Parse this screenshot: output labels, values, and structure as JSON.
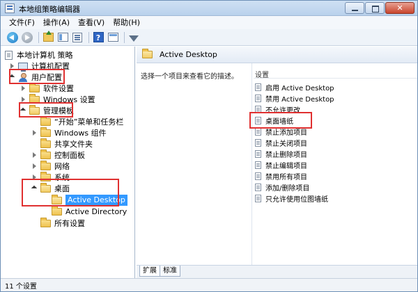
{
  "window": {
    "title": "本地组策略编辑器"
  },
  "menu": {
    "items": [
      "文件(F)",
      "操作(A)",
      "查看(V)",
      "帮助(H)"
    ]
  },
  "tree": {
    "items": [
      {
        "label": "本地计算机 策略"
      },
      {
        "label": "计算机配置"
      },
      {
        "label": "用户配置"
      },
      {
        "label": "软件设置"
      },
      {
        "label": "Windows 设置"
      },
      {
        "label": "管理模板"
      },
      {
        "label": "“开始”菜单和任务栏"
      },
      {
        "label": "Windows 组件"
      },
      {
        "label": "共享文件夹"
      },
      {
        "label": "控制面板"
      },
      {
        "label": "网络"
      },
      {
        "label": "系统"
      },
      {
        "label": "桌面"
      },
      {
        "label": "Active Desktop"
      },
      {
        "label": "Active Directory"
      },
      {
        "label": "所有设置"
      }
    ]
  },
  "right": {
    "header": "Active Desktop",
    "description": "选择一个项目来查看它的描述。",
    "column": "设置",
    "settings": [
      "启用 Active Desktop",
      "禁用 Active Desktop",
      "不允许更改",
      "桌面墙纸",
      "禁止添加项目",
      "禁止关闭项目",
      "禁止删除项目",
      "禁止编辑项目",
      "禁用所有项目",
      "添加/删除项目",
      "只允许使用位图墙纸"
    ],
    "tabs": [
      "扩展",
      "标准"
    ]
  },
  "status": {
    "text": "11 个设置"
  },
  "colors": {
    "highlight": "#3399ff",
    "annotation": "#e03030"
  }
}
